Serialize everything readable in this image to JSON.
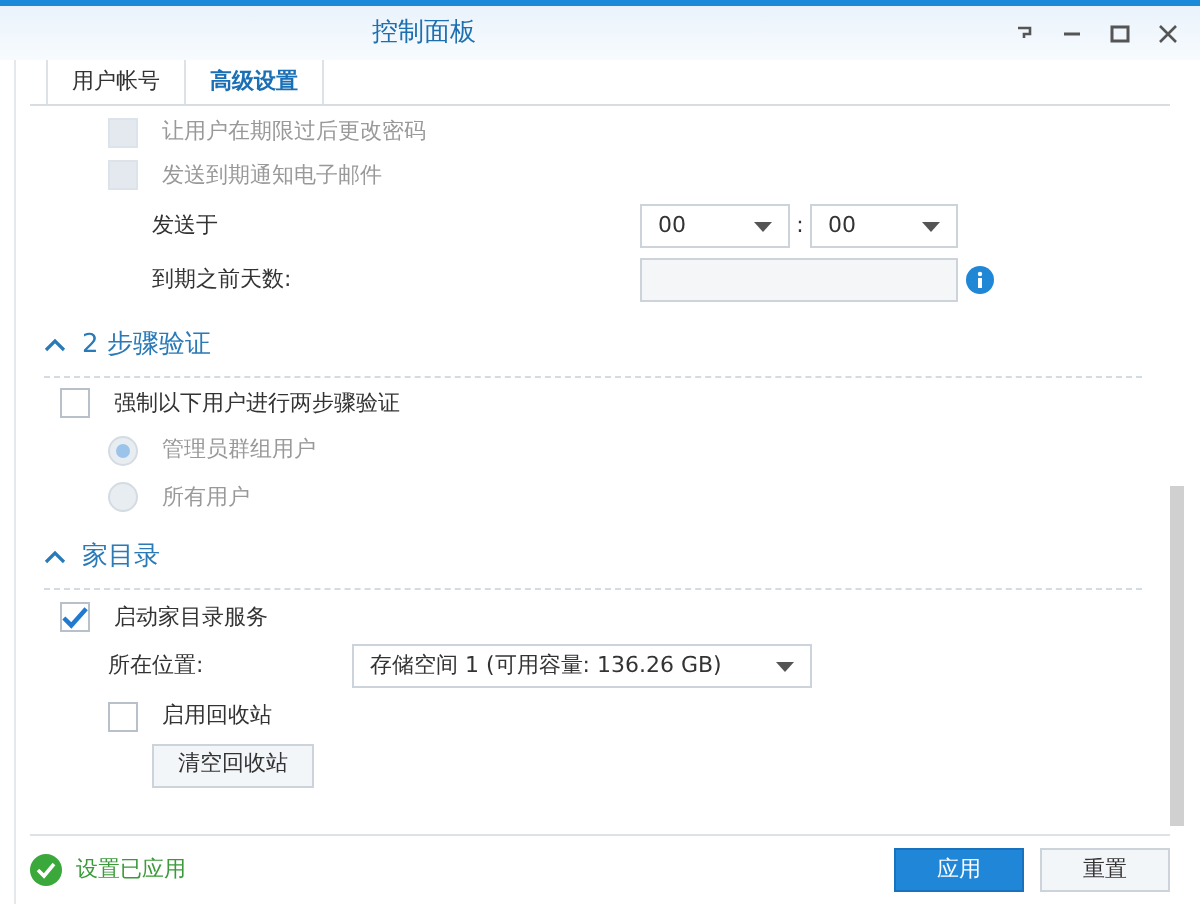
{
  "window": {
    "title": "控制面板"
  },
  "tabs": [
    {
      "label": "用户帐号",
      "selected": false
    },
    {
      "label": "高级设置",
      "selected": true
    }
  ],
  "expiry": {
    "items": [
      {
        "label": "让用户在期限过后更改密码",
        "checked": false,
        "disabled": true
      },
      {
        "label": "发送到期通知电子邮件",
        "checked": false,
        "disabled": true
      }
    ],
    "send_at": {
      "label": "发送于",
      "hour": "00",
      "separator": ":",
      "minute": "00"
    },
    "days_before": {
      "label": "到期之前天数:"
    }
  },
  "two_step": {
    "title": "2 步骤验证",
    "expanded": true,
    "enforce": {
      "label": "强制以下用户进行两步骤验证",
      "checked": false
    },
    "options": [
      {
        "label": "管理员群组用户",
        "selected": true
      },
      {
        "label": "所有用户",
        "selected": false
      }
    ]
  },
  "home": {
    "title": "家目录",
    "expanded": true,
    "enable": {
      "label": "启动家目录服务",
      "checked": true
    },
    "location": {
      "label": "所在位置:",
      "value": "存储空间 1 (可用容量:  136.26 GB)"
    },
    "recycle": {
      "label": "启用回收站",
      "checked": false
    },
    "empty_button": "清空回收站"
  },
  "status_bar": {
    "message": "设置已应用",
    "buttons": [
      {
        "label": "应用",
        "primary": true
      },
      {
        "label": "重置",
        "primary": false
      }
    ]
  }
}
